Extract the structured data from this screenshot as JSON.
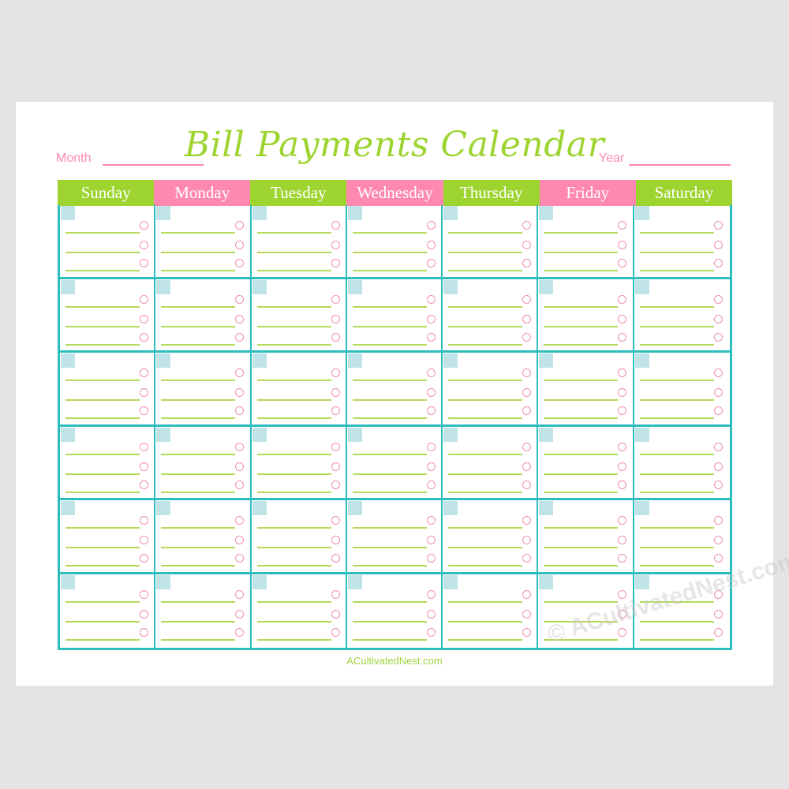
{
  "title": "Bill Payments Calendar",
  "fields": {
    "month_label": "Month",
    "year_label": "Year"
  },
  "colors": {
    "green": "#9dd42f",
    "pink": "#ff88b0",
    "teal": "#2ebdbd",
    "date_box": "#bfe3e6",
    "bill_line": "#b5d95a",
    "check_circle": "#ef8fb2"
  },
  "days": [
    {
      "label": "Sunday",
      "color": "green"
    },
    {
      "label": "Monday",
      "color": "pink"
    },
    {
      "label": "Tuesday",
      "color": "green"
    },
    {
      "label": "Wednesday",
      "color": "pink"
    },
    {
      "label": "Thursday",
      "color": "green"
    },
    {
      "label": "Friday",
      "color": "pink"
    },
    {
      "label": "Saturday",
      "color": "green"
    }
  ],
  "grid": {
    "weeks": 6,
    "days_per_week": 7,
    "bill_lines_per_cell": 3
  },
  "footer": "ACultivatedNest.com",
  "watermark": "© ACultivatedNest.com"
}
